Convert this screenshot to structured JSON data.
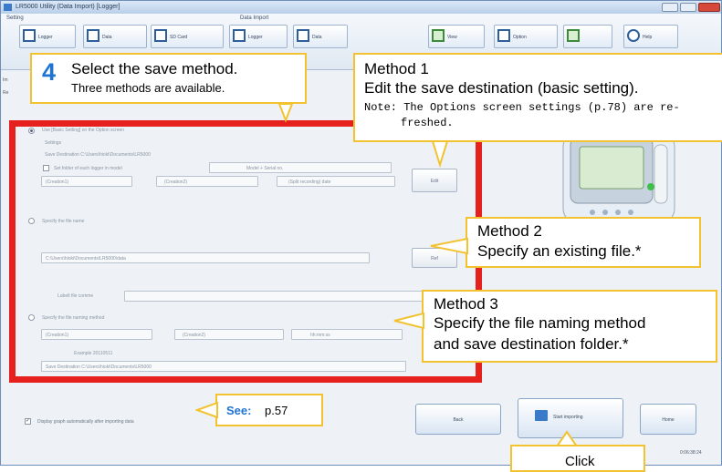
{
  "window": {
    "title": "LR5000 Utility (Data Import) [Logger]"
  },
  "ribbon": {
    "setting_label": "Setting",
    "data_import_label": "Data Import",
    "buttons": [
      "Logger",
      "Data",
      "SD Card",
      "Logger",
      "Data",
      "View",
      "Option",
      "Help"
    ]
  },
  "screen": {
    "sidebar_labels": [
      "Im",
      "Re"
    ],
    "option1_label": "Use [Basic Setting] on the Option screen",
    "settings_heading": "Settings",
    "save_destination": "Save Destination C:\\Users\\hioki\\Documents\\LR5000",
    "checkbox_folder": "Set folder of each logger in model",
    "model_select": "Model + Serial no.",
    "condition1": "(Creation1)",
    "condition2": "(Creation2)",
    "condition3": "(Split recording) date",
    "edit_button": "Edit",
    "option2_label": "Specify the file name",
    "file_path": "C:\\Users\\hioki\\Documents\\LR5000\\data",
    "ref_button": "Ref",
    "comment_label": "Lubelt file comme",
    "option3_label": "Specify the file naming method",
    "naming1": "(Creation1)",
    "naming2": "(Creation2)",
    "naming3": "hh:mm:ss",
    "example_label": "Example 20110511",
    "save_destination2": "Save Destination   C:\\Users\\hioki\\Documents\\LR5000",
    "display_graph": "Display graph automatically after importing data",
    "back_button": "Back",
    "start_import_button": "Start importing",
    "home_button": "Home",
    "time_readout": "0:06:38:24"
  },
  "callouts": {
    "step": {
      "number": "4",
      "title": "Select the save method.",
      "subtitle": "Three methods are available."
    },
    "method1": {
      "heading": "Method 1",
      "text": "Edit the save destination (basic setting).",
      "note_label": "Note:",
      "note": "The Options screen settings (p.78) are re-",
      "note2": "freshed."
    },
    "method2": {
      "heading": "Method 2",
      "text": "Specify an existing file.*"
    },
    "method3": {
      "heading": "Method 3",
      "text": "Specify the file naming method",
      "text2": "and save destination folder.*"
    },
    "see": {
      "label": "See:",
      "page": "p.57"
    },
    "click": {
      "label": "Click"
    }
  },
  "colors": {
    "accent_yellow": "#f2c230",
    "frame_red": "#e5201d",
    "step_blue": "#1f73d2"
  }
}
